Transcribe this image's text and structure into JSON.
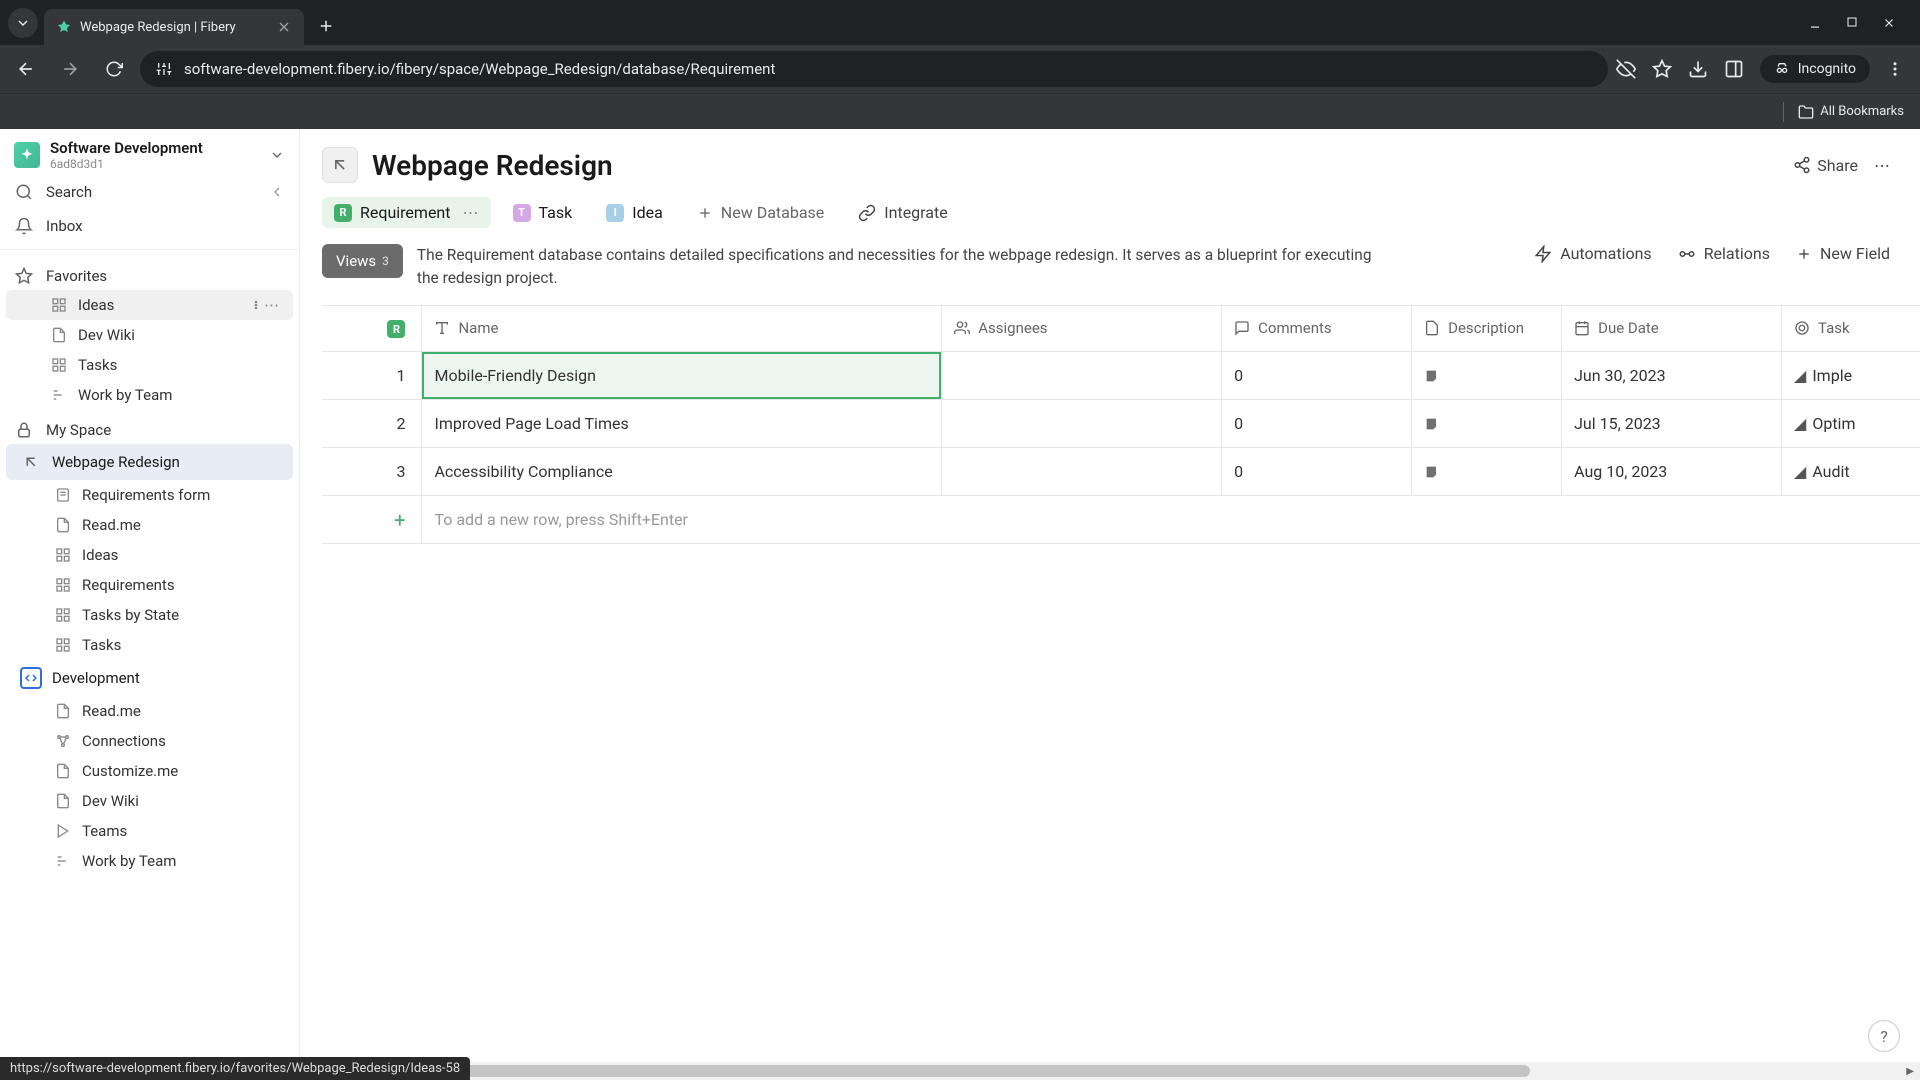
{
  "browser": {
    "tab_title": "Webpage Redesign | Fibery",
    "url": "software-development.fibery.io/fibery/space/Webpage_Redesign/database/Requirement",
    "incognito_label": "Incognito",
    "all_bookmarks": "All Bookmarks",
    "status_link": "https://software-development.fibery.io/favorites/Webpage_Redesign/Ideas-58"
  },
  "workspace": {
    "name": "Software Development",
    "id": "6ad8d3d1"
  },
  "nav": {
    "search": "Search",
    "inbox": "Inbox",
    "favorites": "Favorites",
    "my_space": "My Space"
  },
  "favorites": [
    {
      "label": "Ideas",
      "icon": "board"
    },
    {
      "label": "Dev Wiki",
      "icon": "doc"
    },
    {
      "label": "Tasks",
      "icon": "board"
    },
    {
      "label": "Work by Team",
      "icon": "bars"
    }
  ],
  "spaces": {
    "webpage_redesign": {
      "label": "Webpage Redesign",
      "children": [
        {
          "label": "Requirements form",
          "icon": "form"
        },
        {
          "label": "Read.me",
          "icon": "doc"
        },
        {
          "label": "Ideas",
          "icon": "board"
        },
        {
          "label": "Requirements",
          "icon": "board"
        },
        {
          "label": "Tasks by State",
          "icon": "board"
        },
        {
          "label": "Tasks",
          "icon": "board"
        }
      ]
    },
    "development": {
      "label": "Development",
      "children": [
        {
          "label": "Read.me",
          "icon": "doc"
        },
        {
          "label": "Connections",
          "icon": "graph"
        },
        {
          "label": "Customize.me",
          "icon": "doc"
        },
        {
          "label": "Dev Wiki",
          "icon": "doc"
        },
        {
          "label": "Teams",
          "icon": "play"
        },
        {
          "label": "Work by Team",
          "icon": "bars"
        }
      ]
    }
  },
  "page": {
    "title": "Webpage Redesign",
    "share": "Share"
  },
  "dbs": {
    "requirement": "Requirement",
    "task": "Task",
    "idea": "Idea",
    "new_db": "New Database",
    "integrate": "Integrate"
  },
  "views": {
    "label": "Views",
    "count": "3"
  },
  "description": "The Requirement database contains detailed specifications and necessities for the webpage redesign. It serves as a blueprint for executing the redesign project.",
  "actions": {
    "automations": "Automations",
    "relations": "Relations",
    "new_field": "New Field"
  },
  "columns": {
    "name": "Name",
    "assignees": "Assignees",
    "comments": "Comments",
    "description": "Description",
    "due_date": "Due Date",
    "task": "Task"
  },
  "rows": [
    {
      "num": "1",
      "name": "Mobile-Friendly Design",
      "assignees": "",
      "comments": "0",
      "due": "Jun 30, 2023",
      "task": "Imple"
    },
    {
      "num": "2",
      "name": "Improved Page Load Times",
      "assignees": "",
      "comments": "0",
      "due": "Jul 15, 2023",
      "task": "Optim"
    },
    {
      "num": "3",
      "name": "Accessibility Compliance",
      "assignees": "",
      "comments": "0",
      "due": "Aug 10, 2023",
      "task": "Audit"
    }
  ],
  "add_row_hint": "To add a new row, press Shift+Enter",
  "help": "?"
}
